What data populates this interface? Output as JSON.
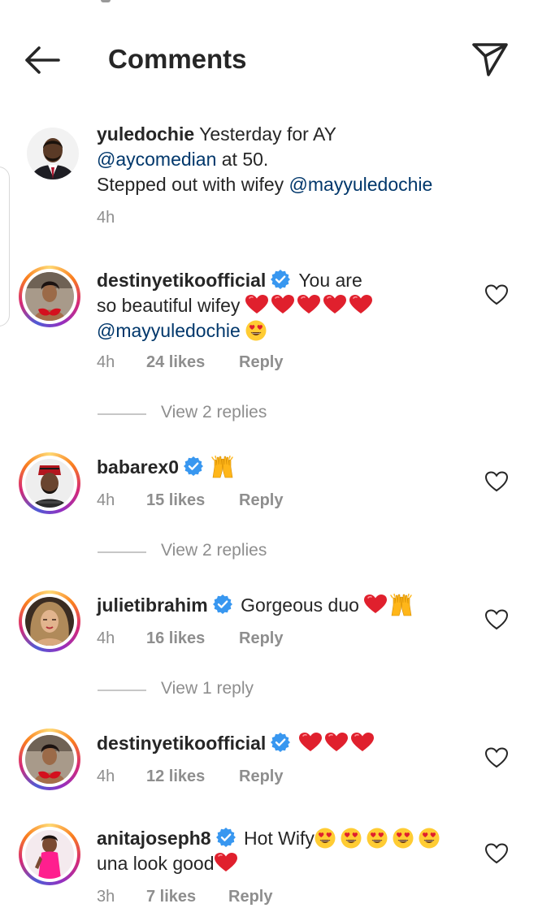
{
  "header": {
    "title": "Comments",
    "back_icon": "arrow-left-icon",
    "share_icon": "paper-plane-icon"
  },
  "caption": {
    "username": "yuledochie",
    "text_1": "Yesterday for AY",
    "mention_1": "@aycomedian",
    "text_2": "at 50.",
    "text_3": "Stepped out with wifey",
    "mention_2": "@mayyuledochie",
    "time": "4h"
  },
  "comments": [
    {
      "username": "destinyetikoofficial",
      "verified": true,
      "text_1": "You are",
      "text_2": "so beautiful wifey",
      "mention": "@mayyuledochie",
      "emoji": "red-heart x5, heart-eyes",
      "time": "4h",
      "likes": "24 likes",
      "reply": "Reply",
      "view_replies": "View 2 replies"
    },
    {
      "username": "babarex0",
      "verified": true,
      "emoji": "raising-hands",
      "time": "4h",
      "likes": "15 likes",
      "reply": "Reply",
      "view_replies": "View 2 replies"
    },
    {
      "username": "julietibrahim",
      "verified": true,
      "text_1": "Gorgeous duo",
      "emoji": "red-heart, raising-hands",
      "time": "4h",
      "likes": "16 likes",
      "reply": "Reply",
      "view_replies": "View 1 reply"
    },
    {
      "username": "destinyetikoofficial",
      "verified": true,
      "emoji": "red-heart x3",
      "time": "4h",
      "likes": "12 likes",
      "reply": "Reply"
    },
    {
      "username": "anitajoseph8",
      "verified": true,
      "text_1": "Hot Wify",
      "text_2": "una look good",
      "emoji": "heart-eyes x5, red-heart",
      "time": "3h",
      "likes": "7 likes",
      "reply": "Reply"
    }
  ],
  "colors": {
    "mention": "#00376b",
    "meta": "#8e8e8e",
    "verified": "#3897f0",
    "heart": "#e0202d"
  }
}
